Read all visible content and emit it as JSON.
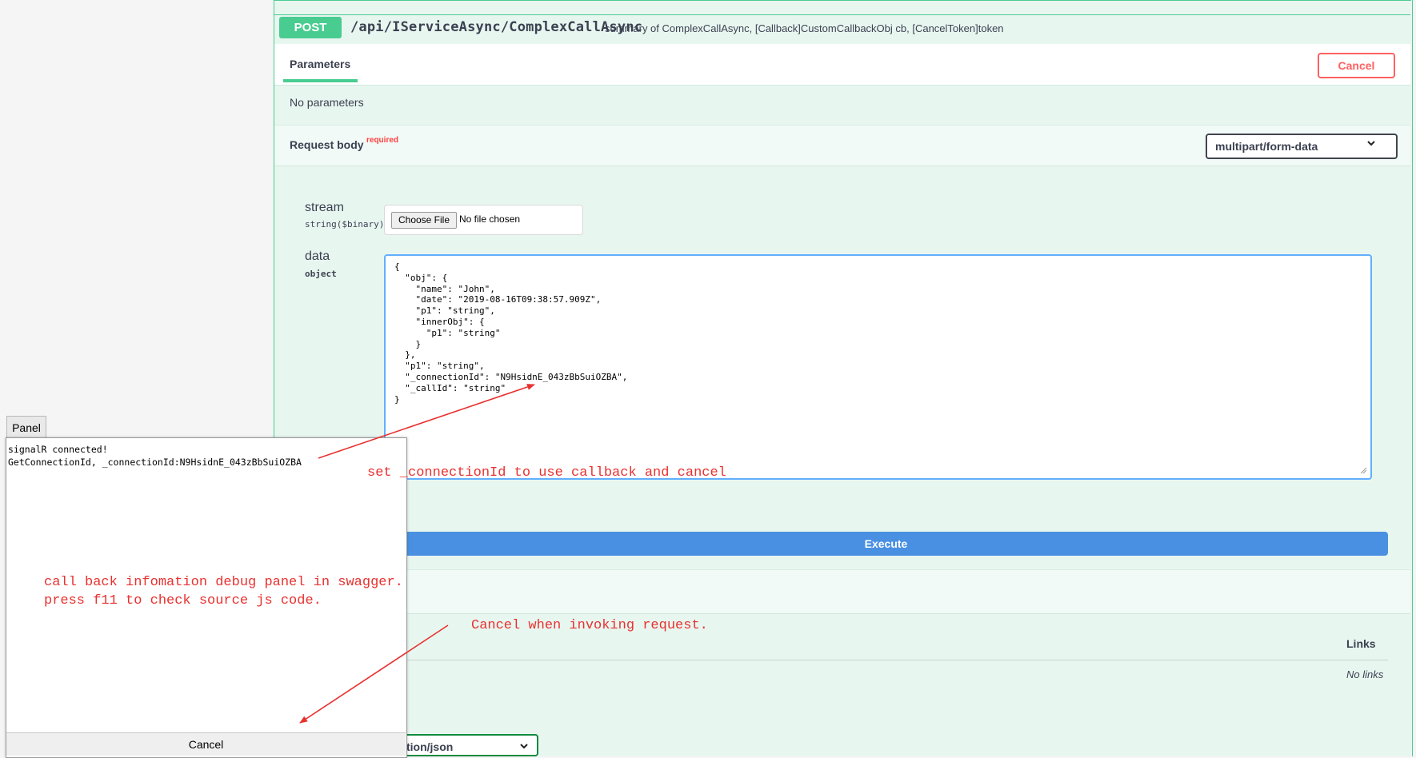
{
  "operation": {
    "method": "POST",
    "path": "/api/IServiceAsync/ComplexCallAsync",
    "summary": "summary of ComplexCallAsync, [Callback]CustomCallbackObj cb, [CancelToken]token"
  },
  "parameters": {
    "tab_label": "Parameters",
    "cancel_label": "Cancel",
    "empty_text": "No parameters"
  },
  "request_body": {
    "title": "Request body",
    "required_badge": "required",
    "content_type": "multipart/form-data",
    "fields": {
      "stream": {
        "name": "stream",
        "type": "string($binary)",
        "choose_file_label": "Choose File",
        "file_status": "No file chosen"
      },
      "data": {
        "name": "data",
        "type": "object",
        "value": "{\n  \"obj\": {\n    \"name\": \"John\",\n    \"date\": \"2019-08-16T09:38:57.909Z\",\n    \"p1\": \"string\",\n    \"innerObj\": {\n      \"p1\": \"string\"\n    }\n  },\n  \"p1\": \"string\",\n  \"_connectionId\": \"N9HsidnE_043zBbSuiOZBA\",\n  \"_callId\": \"string\"\n}"
      }
    }
  },
  "execute_label": "Execute",
  "responses": {
    "links_header": "Links",
    "no_links": "No links",
    "media_type_partial": "tion/json"
  },
  "debug_panel": {
    "tab_label": "Panel",
    "log": "signalR connected!\nGetConnectionId, _connectionId:N9HsidnE_043zBbSuiOZBA",
    "cancel_label": "Cancel"
  },
  "annotations": {
    "set_connection": "set _connectionId to use callback and cancel",
    "panel_note": "call back infomation debug panel in swagger.\npress f11 to check source js code.",
    "cancel_note": "Cancel when invoking request."
  },
  "colors": {
    "post_green": "#49cc90",
    "cancel_red": "#ff6060",
    "execute_blue": "#4990e2",
    "annotation_red": "#e8312f"
  }
}
